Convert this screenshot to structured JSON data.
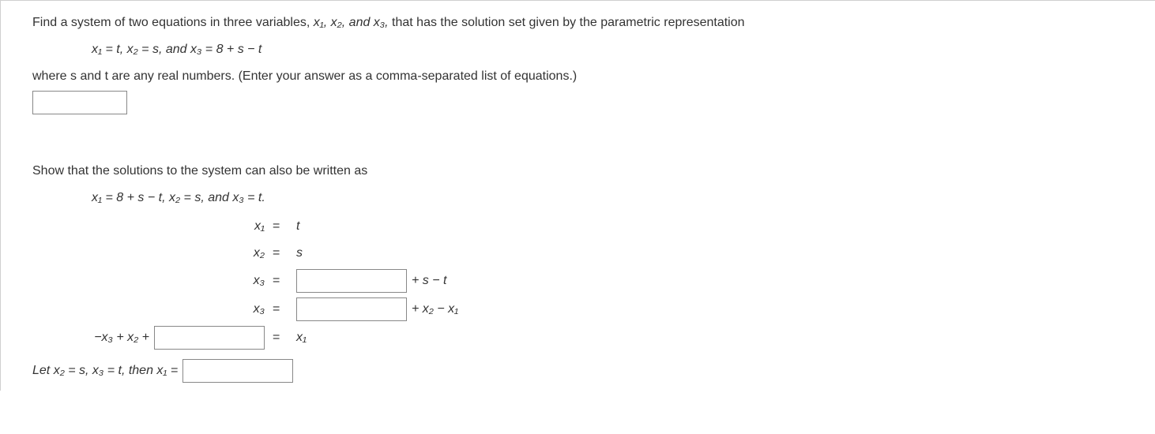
{
  "q1": {
    "intro_a": "Find a system of two equations in three variables, ",
    "vars": "x₁,  x₂,  and  x₃,",
    "intro_b": "  that has the solution set given by the parametric representation",
    "param": "x₁ = t,   x₂ = s,   and   x₃ = 8 + s − t",
    "where": "where s and t are any real numbers. (Enter your answer as a comma-separated list of equations.)"
  },
  "q2": {
    "show": "Show that the solutions to the system can also be written as",
    "param": "x₁ = 8 + s − t,   x₂ = s,   and   x₃ = t.",
    "rows": {
      "r1_lhs": "x₁",
      "r1_rhs": "t",
      "r2_lhs": "x₂",
      "r2_rhs": "s",
      "r3_lhs": "x₃",
      "r3_tail": " + s − t",
      "r4_lhs": "x₃",
      "r4_tail": " + x₂ − x₁",
      "r5_pre": "−x₃ + x₂ + ",
      "r5_rhs": "x₁"
    },
    "let": {
      "pre": "Let x₂ = s, x₃ = t, then x₁ = "
    }
  },
  "eq_sign": "="
}
